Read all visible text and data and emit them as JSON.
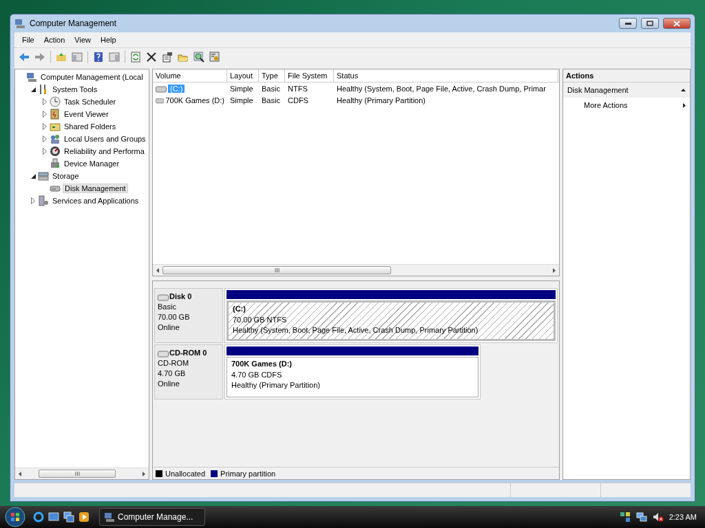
{
  "window": {
    "title": "Computer Management"
  },
  "menu": [
    "File",
    "Action",
    "View",
    "Help"
  ],
  "tree": [
    {
      "label": "Computer Management (Local",
      "selected": false,
      "children": [
        {
          "label": "System Tools",
          "expanded": true,
          "selected": false,
          "children": [
            {
              "label": "Task Scheduler",
              "expanded": false,
              "selected": false
            },
            {
              "label": "Event Viewer",
              "expanded": false,
              "selected": false
            },
            {
              "label": "Shared Folders",
              "expanded": false,
              "selected": false
            },
            {
              "label": "Local Users and Groups",
              "expanded": false,
              "selected": false
            },
            {
              "label": "Reliability and Performa",
              "expanded": false,
              "selected": false
            },
            {
              "label": "Device Manager",
              "selected": false
            }
          ]
        },
        {
          "label": "Storage",
          "expanded": true,
          "selected": false,
          "children": [
            {
              "label": "Disk Management",
              "selected": true
            }
          ]
        },
        {
          "label": "Services and Applications",
          "expanded": false,
          "selected": false
        }
      ]
    }
  ],
  "volumes": {
    "columns": [
      "Volume",
      "Layout",
      "Type",
      "File System",
      "Status"
    ],
    "rows": [
      {
        "cells": [
          "(C:)",
          "Simple",
          "Basic",
          "NTFS",
          "Healthy (System, Boot, Page File, Active, Crash Dump, Primar"
        ],
        "selected": true
      },
      {
        "cells": [
          "700K Games (D:)",
          "Simple",
          "Basic",
          "CDFS",
          "Healthy (Primary Partition)"
        ],
        "selected": false
      }
    ]
  },
  "disks": [
    {
      "kind": "basic",
      "name": "Disk 0",
      "type": "Basic",
      "size": "70.00 GB",
      "status": "Online",
      "partition": {
        "name": "(C:)",
        "detail": "70.00 GB NTFS",
        "status": "Healthy (System, Boot, Page File, Active, Crash Dump, Primary Partition)",
        "selected": true
      }
    },
    {
      "kind": "cdrom",
      "name": "CD-ROM 0",
      "type": "CD-ROM",
      "size": "4.70 GB",
      "status": "Online",
      "partition": {
        "name": "700K Games  (D:)",
        "detail": "4.70 GB CDFS",
        "status": "Healthy (Primary Partition)",
        "selected": false
      }
    }
  ],
  "legend": [
    {
      "label": "Unallocated",
      "color": "#000000"
    },
    {
      "label": "Primary partition",
      "color": "#000080"
    }
  ],
  "actions": {
    "title": "Actions",
    "section": "Disk Management",
    "items": [
      "More Actions"
    ]
  },
  "taskbar": {
    "task": "Computer Manage...",
    "time": "2:23 AM"
  }
}
